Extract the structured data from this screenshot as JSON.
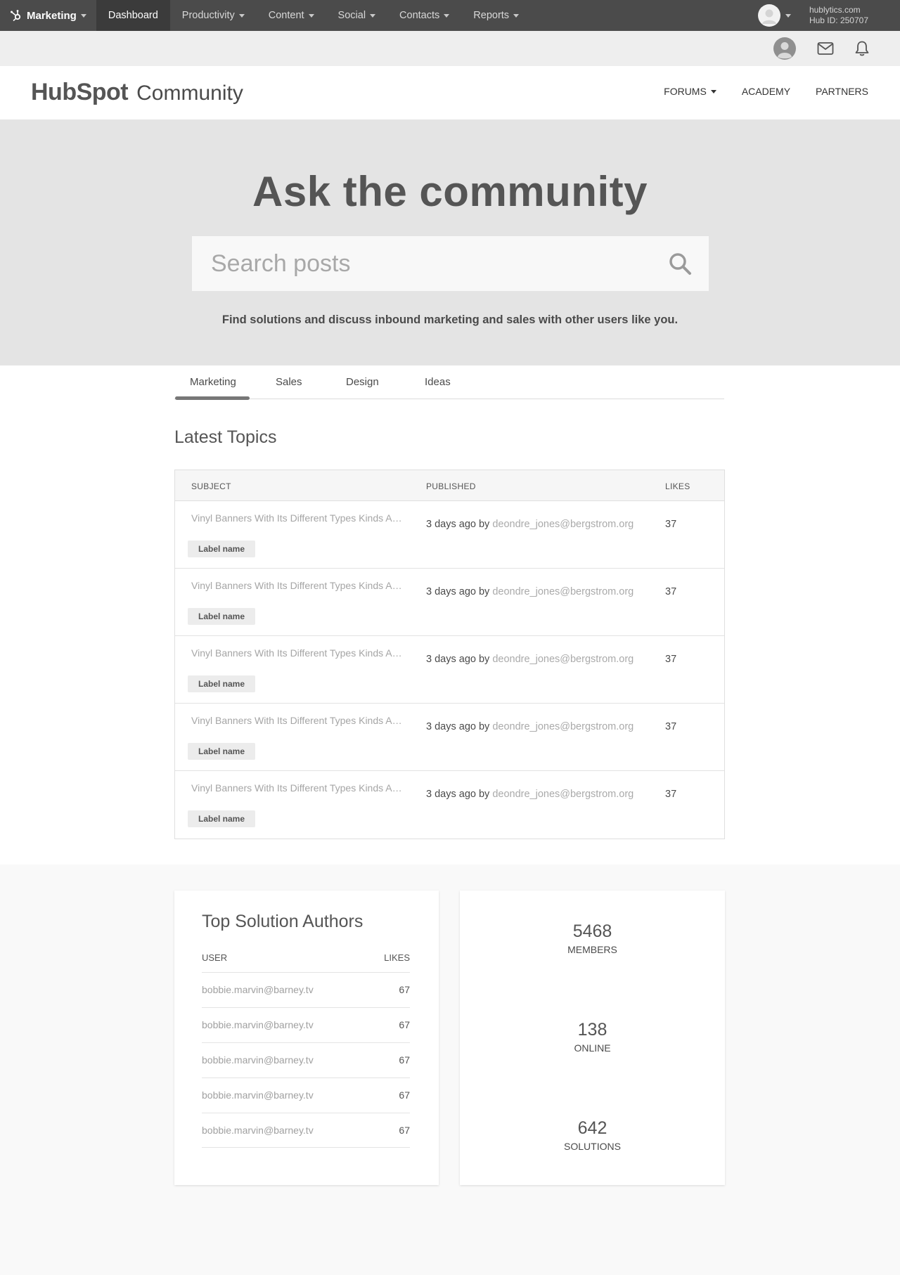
{
  "topnav": {
    "brand": "Marketing",
    "items": [
      {
        "label": "Dashboard",
        "active": true,
        "caret": false
      },
      {
        "label": "Productivity",
        "active": false,
        "caret": true
      },
      {
        "label": "Content",
        "active": false,
        "caret": true
      },
      {
        "label": "Social",
        "active": false,
        "caret": true
      },
      {
        "label": "Contacts",
        "active": false,
        "caret": true
      },
      {
        "label": "Reports",
        "active": false,
        "caret": true
      }
    ],
    "account_domain": "hublytics.com",
    "hub_id": "Hub ID: 250707"
  },
  "subbar": {
    "icons": [
      "user-avatar-icon",
      "mail-icon",
      "bell-icon"
    ]
  },
  "header": {
    "logo_brand": "HubSpot",
    "logo_suffix": "Community",
    "menu": {
      "forums": "FORUMS",
      "academy": "ACADEMY",
      "partners": "PARTNERS"
    }
  },
  "hero": {
    "title": "Ask the community",
    "search_placeholder": "Search posts",
    "tagline": "Find solutions and discuss inbound marketing and sales with other users like you."
  },
  "tabs": [
    "Marketing",
    "Sales",
    "Design",
    "Ideas"
  ],
  "active_tab": "Marketing",
  "latest": {
    "title": "Latest Topics",
    "columns": {
      "subject": "SUBJECT",
      "published": "PUBLISHED",
      "likes": "LIKES"
    },
    "rows": [
      {
        "subject": "Vinyl Banners With Its Different Types Kinds And Uses",
        "label": "Label name",
        "published": "3 days ago by",
        "user": "deondre_jones@bergstrom.org",
        "likes": "37"
      },
      {
        "subject": "Vinyl Banners With Its Different Types Kinds And Uses",
        "label": "Label name",
        "published": "3 days ago by",
        "user": "deondre_jones@bergstrom.org",
        "likes": "37"
      },
      {
        "subject": "Vinyl Banners With Its Different Types Kinds And Uses",
        "label": "Label name",
        "published": "3 days ago by",
        "user": "deondre_jones@bergstrom.org",
        "likes": "37"
      },
      {
        "subject": "Vinyl Banners With Its Different Types Kinds And Uses",
        "label": "Label name",
        "published": "3 days ago by",
        "user": "deondre_jones@bergstrom.org",
        "likes": "37"
      },
      {
        "subject": "Vinyl Banners With Its Different Types Kinds And Uses",
        "label": "Label name",
        "published": "3 days ago by",
        "user": "deondre_jones@bergstrom.org",
        "likes": "37"
      }
    ]
  },
  "authors": {
    "title": "Top Solution Authors",
    "col_user": "USER",
    "col_likes": "LIKES",
    "rows": [
      {
        "user": "bobbie.marvin@barney.tv",
        "likes": "67"
      },
      {
        "user": "bobbie.marvin@barney.tv",
        "likes": "67"
      },
      {
        "user": "bobbie.marvin@barney.tv",
        "likes": "67"
      },
      {
        "user": "bobbie.marvin@barney.tv",
        "likes": "67"
      },
      {
        "user": "bobbie.marvin@barney.tv",
        "likes": "67"
      }
    ]
  },
  "stats": [
    {
      "value": "5468",
      "caption": "MEMBERS"
    },
    {
      "value": "138",
      "caption": "ONLINE"
    },
    {
      "value": "642",
      "caption": "SOLUTIONS"
    }
  ]
}
